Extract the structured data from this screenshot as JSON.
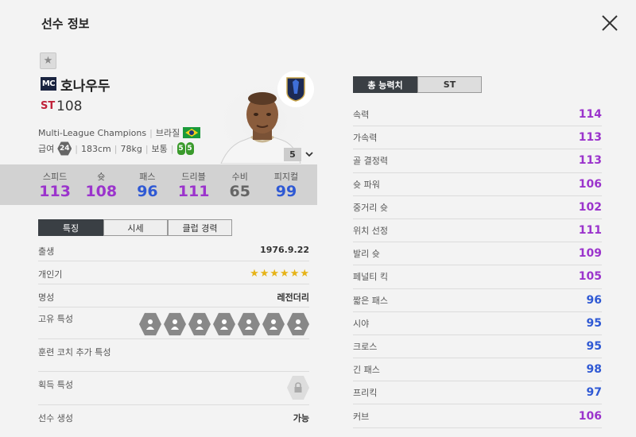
{
  "header": {
    "title": "선수 정보"
  },
  "player": {
    "season_badge": "MC",
    "name": "호나우두",
    "position": "ST",
    "ovr": "108",
    "league": "Multi-League Champions",
    "nation": "브라질",
    "pay_label": "급여",
    "pay": "24",
    "height": "183cm",
    "weight": "78kg",
    "body_type": "보통",
    "left_foot": "5",
    "right_foot": "5",
    "grade": "5"
  },
  "stats": [
    {
      "label": "스피드",
      "value": "113",
      "color": "#9b34cc"
    },
    {
      "label": "슛",
      "value": "108",
      "color": "#9b34cc"
    },
    {
      "label": "패스",
      "value": "96",
      "color": "#2f59d4"
    },
    {
      "label": "드리블",
      "value": "111",
      "color": "#9b34cc"
    },
    {
      "label": "수비",
      "value": "65",
      "color": "#666666"
    },
    {
      "label": "피지컬",
      "value": "99",
      "color": "#2f59d4"
    }
  ],
  "tabs": [
    "특징",
    "시세",
    "클럽 경력"
  ],
  "features": {
    "birth_label": "출생",
    "birth": "1976.9.22",
    "skill_label": "개인기",
    "skill_stars": 6,
    "fame_label": "명성",
    "fame": "레전더리",
    "traits_label": "고유 특성",
    "coach_label": "훈련 코치 추가 특성",
    "acquired_label": "획득 특성",
    "create_label": "선수 생성",
    "create": "가능"
  },
  "trait_icons": [
    "trait-runner-icon",
    "trait-finesse-icon",
    "trait-head-icon",
    "trait-speed-icon",
    "trait-skill-icon",
    "trait-flair-icon",
    "trait-dribble-icon"
  ],
  "right_tabs": [
    "총 능력치",
    "ST"
  ],
  "detail_stats": [
    {
      "label": "속력",
      "value": "114",
      "color": "#9b34cc"
    },
    {
      "label": "가속력",
      "value": "113",
      "color": "#9b34cc"
    },
    {
      "label": "골 결정력",
      "value": "113",
      "color": "#9b34cc"
    },
    {
      "label": "슛 파워",
      "value": "106",
      "color": "#9b34cc"
    },
    {
      "label": "중거리 슛",
      "value": "102",
      "color": "#9b34cc"
    },
    {
      "label": "위치 선정",
      "value": "111",
      "color": "#9b34cc"
    },
    {
      "label": "발리 슛",
      "value": "109",
      "color": "#9b34cc"
    },
    {
      "label": "페널티 킥",
      "value": "105",
      "color": "#9b34cc"
    },
    {
      "label": "짧은 패스",
      "value": "96",
      "color": "#2f59d4"
    },
    {
      "label": "시야",
      "value": "95",
      "color": "#2f59d4"
    },
    {
      "label": "크로스",
      "value": "95",
      "color": "#2f59d4"
    },
    {
      "label": "긴 패스",
      "value": "98",
      "color": "#2f59d4"
    },
    {
      "label": "프리킥",
      "value": "97",
      "color": "#2f59d4"
    },
    {
      "label": "커브",
      "value": "106",
      "color": "#9b34cc"
    }
  ]
}
